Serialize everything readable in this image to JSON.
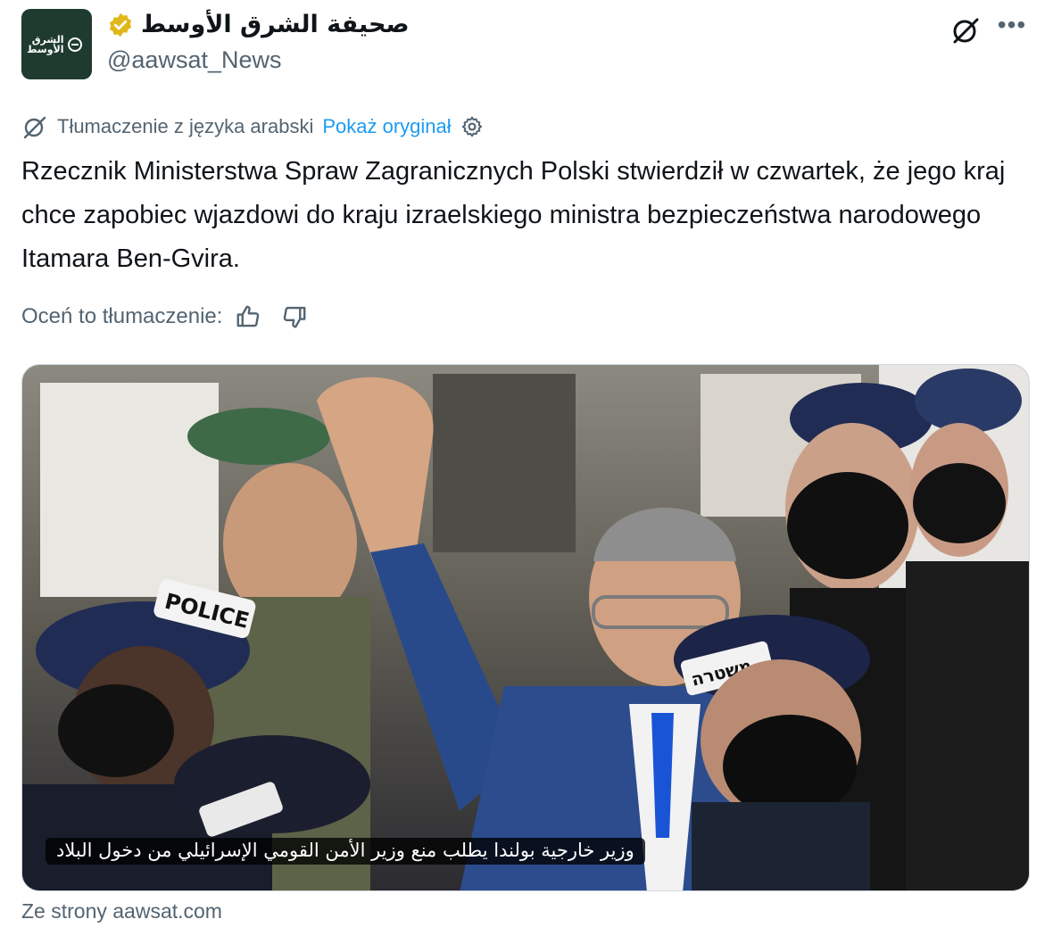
{
  "author": {
    "display_name": "صحيفة الشرق الأوسط",
    "handle": "@aawsat_News",
    "avatar_text": "الشرق الأوسط",
    "verified_badge_color": "#e2b719"
  },
  "icons": {
    "grok": "grok-icon",
    "more": "more-icon",
    "translate": "translate-icon",
    "settings": "settings-icon",
    "thumbs_up": "thumbs-up-icon",
    "thumbs_down": "thumbs-down-icon"
  },
  "translation": {
    "label": "Tłumaczenie z języka arabski",
    "show_original": "Pokaż oryginał"
  },
  "tweet": {
    "text": "Rzecznik Ministerstwa Spraw Zagranicznych Polski stwierdził w czwartek, że jego kraj chce zapobiec wjazdowi do kraju izraelskiego ministra bezpieczeństwa narodowego Itamara Ben-Gvira."
  },
  "rating": {
    "label": "Oceń to tłumaczenie:"
  },
  "media": {
    "badge_police": "POLICE",
    "badge_hebrew": "משטרה",
    "caption": "وزير خارجية بولندا يطلب منع وزير الأمن القومي الإسرائيلي من دخول البلاد"
  },
  "link_source": "Ze strony aawsat.com",
  "colors": {
    "link_blue": "#1d9bf0",
    "secondary_text": "#536471",
    "border": "#cfd9de"
  }
}
